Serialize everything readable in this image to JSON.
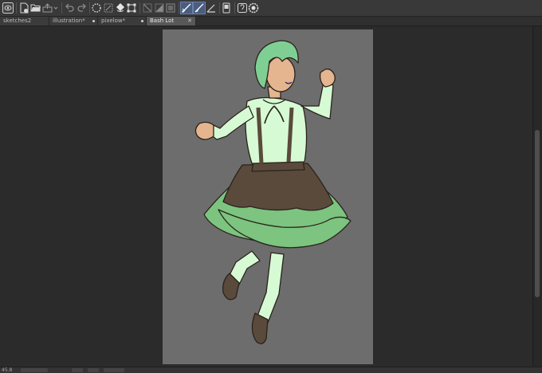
{
  "toolbar": {
    "buttons": [
      {
        "name": "app-logo-icon",
        "icon": "eye"
      },
      {
        "name": "new-file-icon",
        "icon": "new-file"
      },
      {
        "name": "open-folder-icon",
        "icon": "folder"
      },
      {
        "name": "export-icon",
        "icon": "export"
      },
      {
        "name": "undo-icon",
        "icon": "undo"
      },
      {
        "name": "redo-icon",
        "icon": "redo"
      },
      {
        "name": "auto-select-icon",
        "icon": "dotted-circle"
      },
      {
        "name": "clear-icon",
        "icon": "clear"
      },
      {
        "name": "fill-icon",
        "icon": "fill"
      },
      {
        "name": "transform-icon",
        "icon": "transform"
      },
      {
        "name": "hide-selection-icon",
        "icon": "line"
      },
      {
        "name": "color-mix-icon",
        "icon": "gradient"
      },
      {
        "name": "selection-frame-icon",
        "icon": "frame"
      },
      {
        "name": "snap-ruler-icon",
        "icon": "ruler-check"
      },
      {
        "name": "snap-special-ruler-icon",
        "icon": "ruler-check-alt"
      },
      {
        "name": "snap-grid-icon",
        "icon": "angle"
      },
      {
        "name": "tablet-icon",
        "icon": "tablet"
      },
      {
        "name": "correction-icon",
        "icon": "correction"
      },
      {
        "name": "settings-icon",
        "icon": "gear"
      }
    ]
  },
  "tabs": [
    {
      "label": "sketches2",
      "modified": false,
      "active": false
    },
    {
      "label": "illustration*",
      "modified": true,
      "active": false
    },
    {
      "label": "pixelow*",
      "modified": true,
      "active": false
    },
    {
      "label": "Bash Lot",
      "modified": false,
      "active": true,
      "close": "✕"
    }
  ],
  "canvas": {
    "background": "#6d6d6d"
  },
  "colors": {
    "hair": "#7fcf94",
    "shirt": "#d6fbd4",
    "skirt": "#7cc47f",
    "apron": "#5a4a3b",
    "skin": "#e4b58f",
    "outline": "#2a221c"
  },
  "status": {
    "zoom": "45.8"
  }
}
